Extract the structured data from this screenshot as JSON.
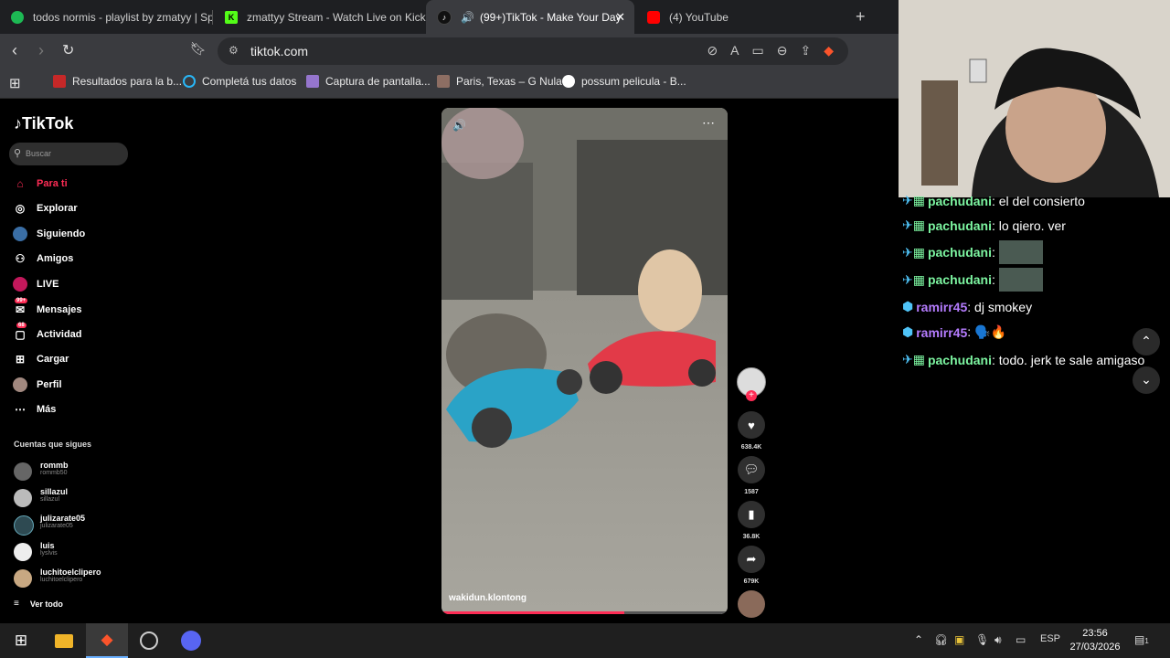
{
  "browser": {
    "tabs": [
      {
        "label": "todos normis - playlist by zmatyy | Sp",
        "icon_color": "#1db954"
      },
      {
        "label": "zmattyy Stream - Watch Live on Kick",
        "icon_color": "#53fc18"
      },
      {
        "label": "(99+)TikTok - Make Your Day",
        "icon_color": "#000000"
      },
      {
        "label": "(4) YouTube",
        "icon_color": "#ff0000"
      }
    ],
    "new_tab_glyph": "+",
    "url": "tiktok.com",
    "bookmarks": [
      "Resultados para la b...",
      "Completá tus datos",
      "Captura de pantalla...",
      "Paris, Texas – G Nula",
      "possum pelicula - B..."
    ]
  },
  "tiktok": {
    "logo": "TikTok",
    "search_placeholder": "Buscar",
    "menu": [
      {
        "label": "Para ti",
        "icon": "home-icon"
      },
      {
        "label": "Explorar",
        "icon": "compass-icon"
      },
      {
        "label": "Siguiendo",
        "icon": "following-icon"
      },
      {
        "label": "Amigos",
        "icon": "friends-icon"
      },
      {
        "label": "LIVE",
        "icon": "live-icon"
      },
      {
        "label": "Mensajes",
        "icon": "messages-icon",
        "badge": "99+"
      },
      {
        "label": "Actividad",
        "icon": "activity-icon",
        "badge": "68"
      },
      {
        "label": "Cargar",
        "icon": "upload-icon"
      },
      {
        "label": "Perfil",
        "icon": "profile-icon"
      },
      {
        "label": "Más",
        "icon": "more-icon"
      }
    ],
    "following_title": "Cuentas que sigues",
    "following": [
      {
        "name": "rommb",
        "handle": "rommb50"
      },
      {
        "name": "sillazul",
        "handle": "sillazul"
      },
      {
        "name": "julizarate05",
        "handle": "julizarate05"
      },
      {
        "name": "luis",
        "handle": "lyslvis"
      },
      {
        "name": "luchitoelclipero",
        "handle": "luchitoelclipero"
      }
    ],
    "see_all": "Ver todo",
    "video": {
      "author": "wakidun.klontong",
      "progress": 0.64,
      "likes": "638.4K",
      "comments": "1587",
      "saves": "36.8K",
      "shares": "679K"
    }
  },
  "chat": {
    "messages": [
      {
        "user": "pachudani",
        "text": ": el del consierto",
        "color": "#7cf4a0"
      },
      {
        "user": "pachudani",
        "text": ": lo qiero. ver",
        "color": "#7cf4a0"
      },
      {
        "user": "pachudani",
        "text": ":",
        "color": "#7cf4a0",
        "emote": true
      },
      {
        "user": "pachudani",
        "text": ":",
        "color": "#7cf4a0",
        "emote": true
      },
      {
        "user": "ramirr45",
        "text": ": dj smokey",
        "color": "#b57cff"
      },
      {
        "user": "ramirr45",
        "text": ": 🗣️🔥",
        "color": "#b57cff"
      },
      {
        "user": "pachudani",
        "text": ": todo. jerk te sale amigaso",
        "color": "#7cf4a0"
      }
    ]
  },
  "taskbar": {
    "language": "ESP",
    "time": "23:56",
    "date": "27/03/2026",
    "notification_count": "1"
  }
}
